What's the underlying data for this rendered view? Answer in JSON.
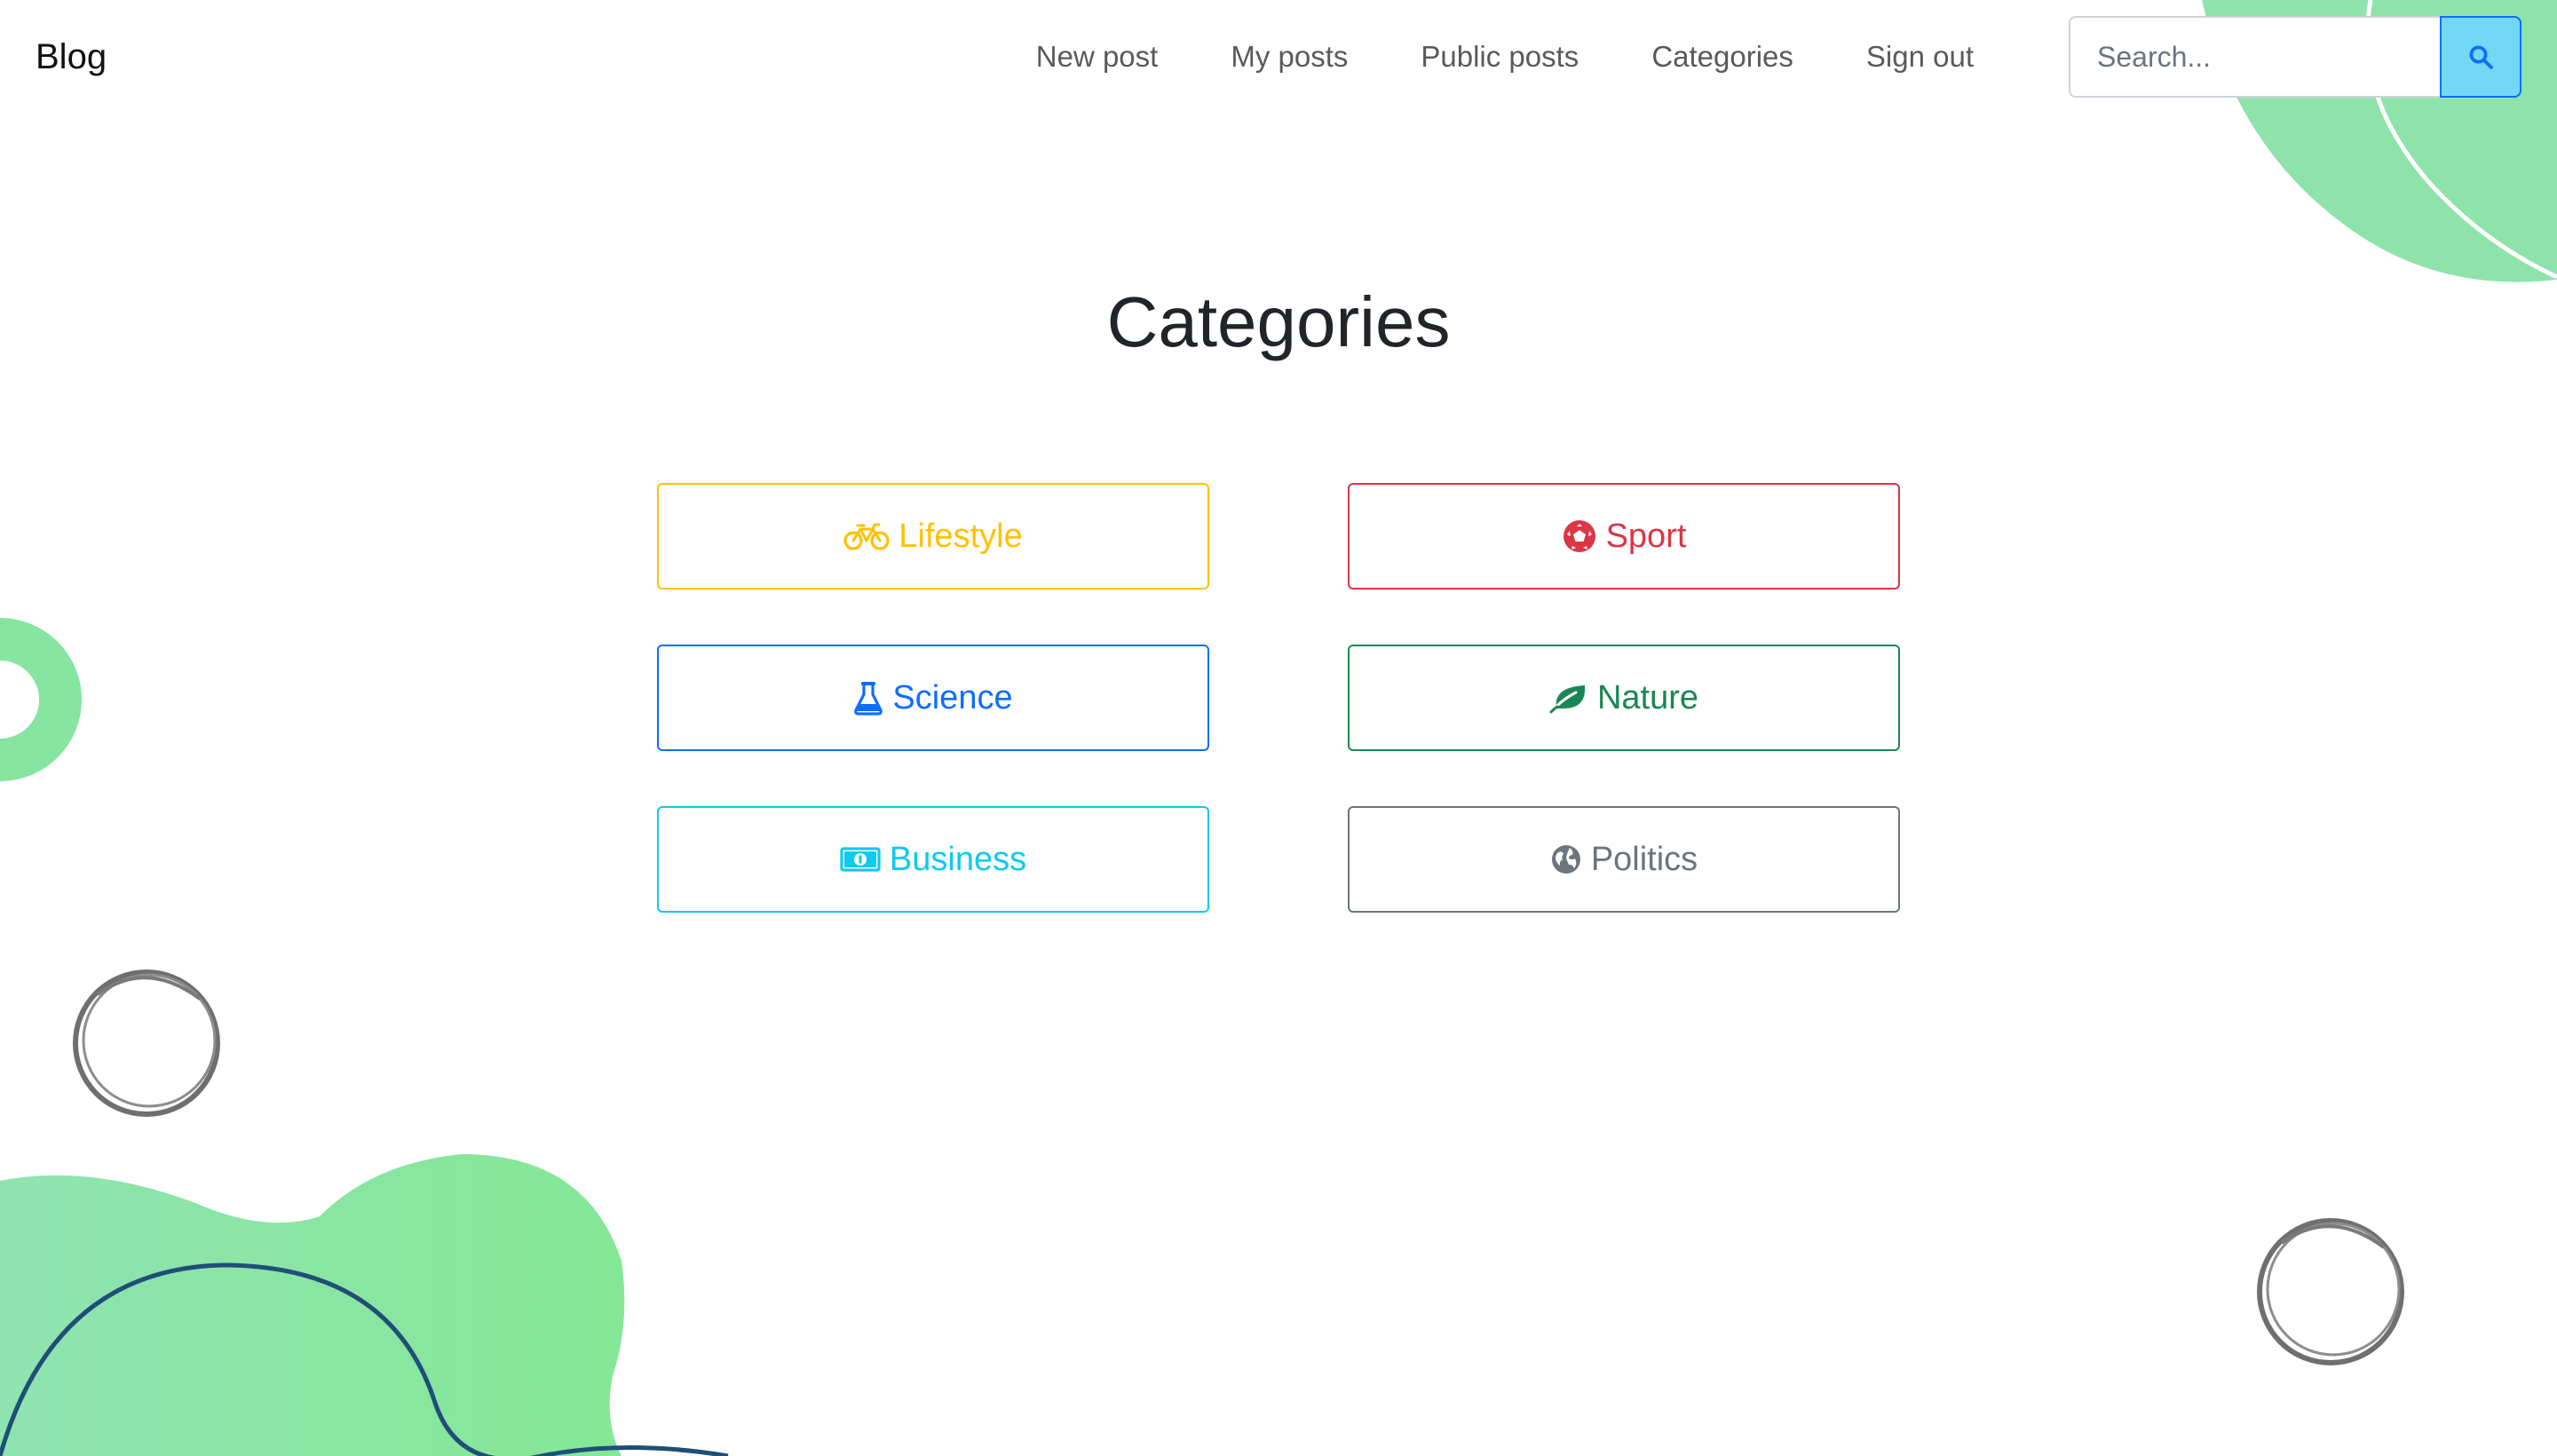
{
  "navbar": {
    "brand": "Blog",
    "links": [
      {
        "label": "New post"
      },
      {
        "label": "My posts"
      },
      {
        "label": "Public posts"
      },
      {
        "label": "Categories"
      },
      {
        "label": "Sign out"
      }
    ],
    "search": {
      "placeholder": "Search...",
      "value": "",
      "button_icon": "search-icon"
    }
  },
  "main": {
    "title": "Categories",
    "categories": [
      {
        "label": "Lifestyle",
        "icon": "bicycle-icon",
        "color": "#ffc107"
      },
      {
        "label": "Sport",
        "icon": "soccer-ball-icon",
        "color": "#dc3545"
      },
      {
        "label": "Science",
        "icon": "flask-icon",
        "color": "#0d6efd"
      },
      {
        "label": "Nature",
        "icon": "leaf-icon",
        "color": "#198754"
      },
      {
        "label": "Business",
        "icon": "money-bill-icon",
        "color": "#0dcaf0"
      },
      {
        "label": "Politics",
        "icon": "globe-icon",
        "color": "#6c757d"
      }
    ]
  },
  "theme": {
    "accent_green": "#86e5a0",
    "search_border": "#0d6efd",
    "search_button_bg": "#73d8f5"
  }
}
